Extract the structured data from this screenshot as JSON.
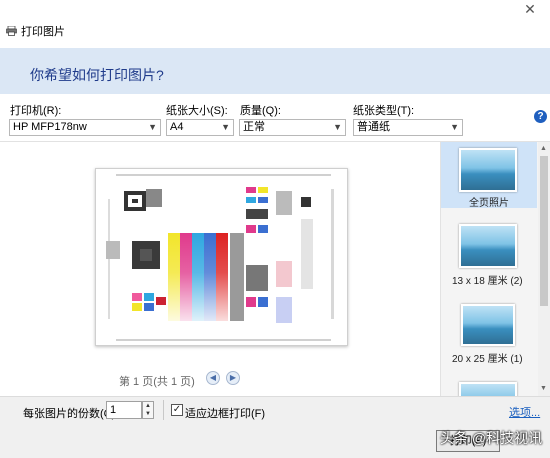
{
  "window": {
    "title": "打印图片"
  },
  "header": {
    "question": "你希望如何打印图片?"
  },
  "options": {
    "printer": {
      "label": "打印机(R):",
      "value": "HP MFP178nw"
    },
    "paper_size": {
      "label": "纸张大小(S):",
      "value": "A4"
    },
    "quality": {
      "label": "质量(Q):",
      "value": "正常"
    },
    "paper_type": {
      "label": "纸张类型(T):",
      "value": "普通纸"
    }
  },
  "preview": {
    "page_indicator": "第 1 页(共 1 页)"
  },
  "layouts": [
    {
      "caption": "全页照片",
      "selected": true
    },
    {
      "caption": "13 x 18 厘米 (2)",
      "selected": false
    },
    {
      "caption": "20 x 25 厘米 (1)",
      "selected": false
    }
  ],
  "footer": {
    "copies_label": "每张图片的份数(C):",
    "copies_value": "1",
    "fit_label": "适应边框打印(F)",
    "fit_checked": true,
    "options_link": "选项...",
    "print_button": "打印(P)"
  },
  "watermark": "头条 @科技视讯",
  "colors": {
    "accent": "#1e3a8a",
    "header_bg": "#dbe7f5",
    "selection": "#cfe3f8"
  }
}
